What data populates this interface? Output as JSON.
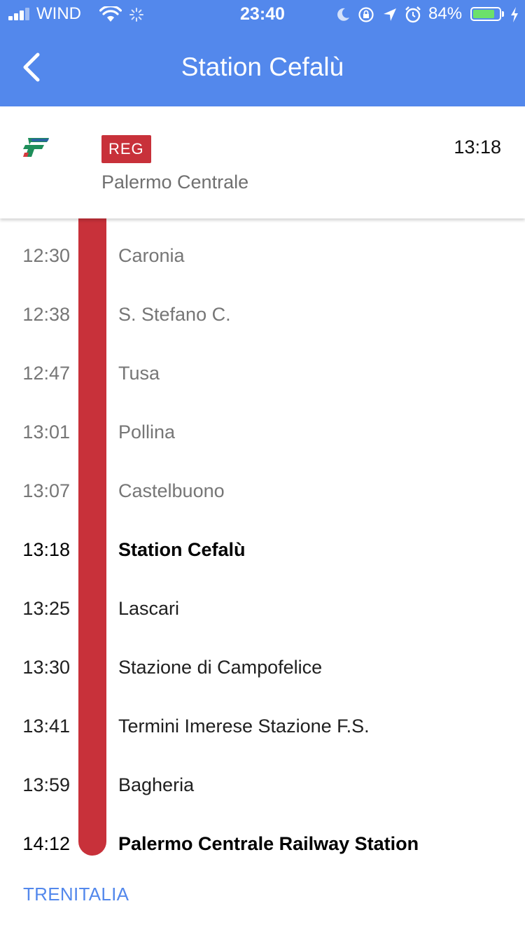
{
  "status_bar": {
    "carrier": "WIND",
    "time": "23:40",
    "battery": "84%",
    "battery_level": 0.84,
    "icons": [
      "signal-icon",
      "wifi-icon",
      "activity-spinner-icon",
      "moon-icon",
      "rotation-lock-icon",
      "location-arrow-icon",
      "alarm-icon",
      "battery-icon",
      "charging-icon"
    ]
  },
  "header": {
    "back_icon": "chevron-left-icon",
    "title": "Station Cefalù"
  },
  "train": {
    "operator_logo": "trenitalia-logo",
    "type": "REG",
    "time": "13:18",
    "destination": "Palermo Centrale"
  },
  "stops": [
    {
      "time": "12:30",
      "name": "Caronia",
      "state": "past"
    },
    {
      "time": "12:38",
      "name": "S. Stefano C.",
      "state": "past"
    },
    {
      "time": "12:47",
      "name": "Tusa",
      "state": "past"
    },
    {
      "time": "13:01",
      "name": "Pollina",
      "state": "past"
    },
    {
      "time": "13:07",
      "name": "Castelbuono",
      "state": "past"
    },
    {
      "time": "13:18",
      "name": "Station Cefalù",
      "state": "current"
    },
    {
      "time": "13:25",
      "name": "Lascari",
      "state": "future"
    },
    {
      "time": "13:30",
      "name": "Stazione di Campofelice",
      "state": "future"
    },
    {
      "time": "13:41",
      "name": "Termini Imerese Stazione F.S.",
      "state": "future"
    },
    {
      "time": "13:59",
      "name": "Bagheria",
      "state": "future"
    },
    {
      "time": "14:12",
      "name": "Palermo Centrale Railway Station",
      "state": "last"
    }
  ],
  "footer": {
    "operator_link": "TRENITALIA"
  },
  "colors": {
    "header_blue": "#5388EC",
    "route_red": "#C8313A",
    "badge_red": "#C8313A",
    "link_blue": "#5388EC",
    "past_text": "#767676",
    "future_text": "#202020"
  }
}
